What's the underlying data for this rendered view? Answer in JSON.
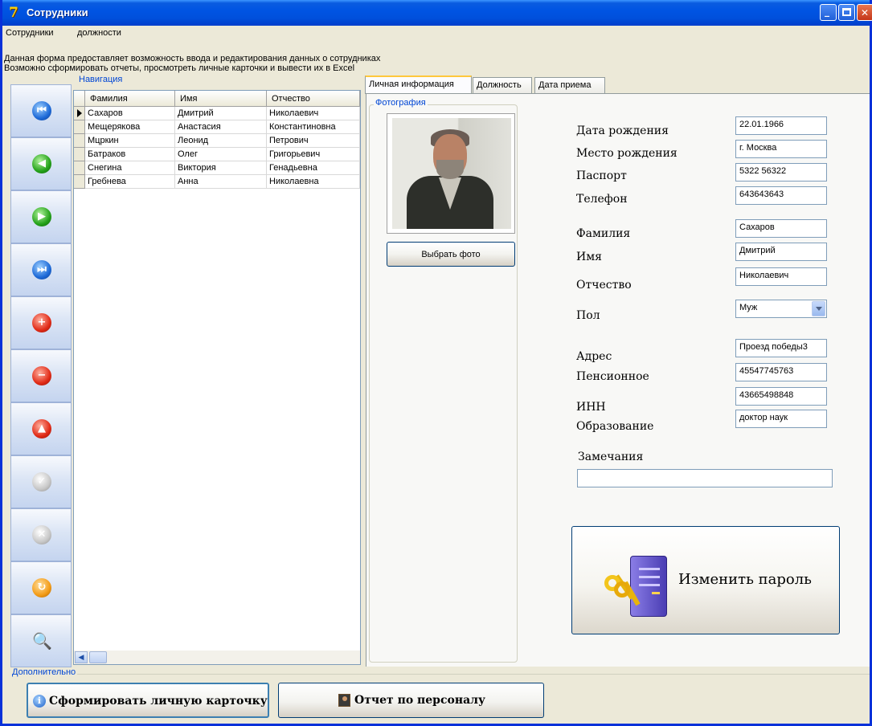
{
  "window": {
    "title": "Сотрудники",
    "icon": "app-icon"
  },
  "menu": [
    "Сотрудники",
    "должности"
  ],
  "info": {
    "line1": "Данная форма предоставляет возможность ввода и редактирования данных о сотрудниках",
    "line2": "Возможно сформировать отчеты, просмотреть личные карточки и вывести их в Excel"
  },
  "navigation": {
    "label": "Навигация",
    "buttons": [
      {
        "name": "first-record-icon",
        "color": "blue",
        "glyph": "⏮"
      },
      {
        "name": "previous-record-icon",
        "color": "green",
        "glyph": "◀"
      },
      {
        "name": "next-record-icon",
        "color": "green",
        "glyph": "▶"
      },
      {
        "name": "last-record-icon",
        "color": "blue",
        "glyph": "⏭"
      },
      {
        "name": "add-record-icon",
        "color": "red",
        "glyph": "+"
      },
      {
        "name": "delete-record-icon",
        "color": "red",
        "glyph": "−"
      },
      {
        "name": "edit-record-icon",
        "color": "red",
        "glyph": "▲"
      },
      {
        "name": "save-record-icon",
        "color": "gray",
        "glyph": "✓"
      },
      {
        "name": "cancel-record-icon",
        "color": "gray",
        "glyph": "✕"
      },
      {
        "name": "refresh-icon",
        "color": "orange",
        "glyph": "↻"
      },
      {
        "name": "search-icon",
        "color": "none",
        "glyph": "🔍"
      }
    ]
  },
  "grid": {
    "columns": [
      "Фамилия",
      "Имя",
      "Отчество"
    ],
    "rows": [
      [
        "Сахаров",
        "Дмитрий",
        "Николаевич"
      ],
      [
        "Мещерякова",
        "Анастасия",
        "Константиновна"
      ],
      [
        "Мцркин",
        "Леонид",
        "Петрович"
      ],
      [
        "Батраков",
        "Олег",
        "Григорьевич"
      ],
      [
        "Снегина",
        "Виктория",
        "Генадьевна"
      ],
      [
        "Гребнева",
        "Анна",
        "Николаевна"
      ]
    ],
    "selected_row": 0
  },
  "tabs": [
    "Личная информация",
    "Должность",
    "Дата приема"
  ],
  "photo": {
    "label": "Фотография",
    "choose_button": "Выбрать фото"
  },
  "form": {
    "birth_date": {
      "label": "Дата рождения",
      "value": "22.01.1966"
    },
    "birth_place": {
      "label": "Место рождения",
      "value": "г. Москва"
    },
    "passport": {
      "label": "Паспорт",
      "value": "5322 56322"
    },
    "phone": {
      "label": "Телефон",
      "value": "643643643"
    },
    "last_name": {
      "label": "Фамилия",
      "value": "Сахаров"
    },
    "first_name": {
      "label": "Имя",
      "value": "Дмитрий"
    },
    "patronymic": {
      "label": "Отчество",
      "value": "Николаевич"
    },
    "gender": {
      "label": "Пол",
      "value": "Муж"
    },
    "address": {
      "label": "Адрес",
      "value": "Проезд победы3"
    },
    "pension": {
      "label": "Пенсионное",
      "value": "45547745763"
    },
    "inn": {
      "label": "ИНН",
      "value": "43665498848"
    },
    "education": {
      "label": "Образование",
      "value": "доктор наук"
    },
    "remarks": {
      "label": "Замечания",
      "value": ""
    }
  },
  "change_password": {
    "label": "Изменить пароль",
    "icon": "key-server-icon"
  },
  "extra": {
    "label": "Дополнительно",
    "card_button": "Сформировать личную карточку",
    "report_button": "Отчет по персоналу"
  },
  "colors": {
    "titlebar": "#0054e3",
    "group_label": "#0046d5",
    "window_bg": "#ece9d8"
  }
}
